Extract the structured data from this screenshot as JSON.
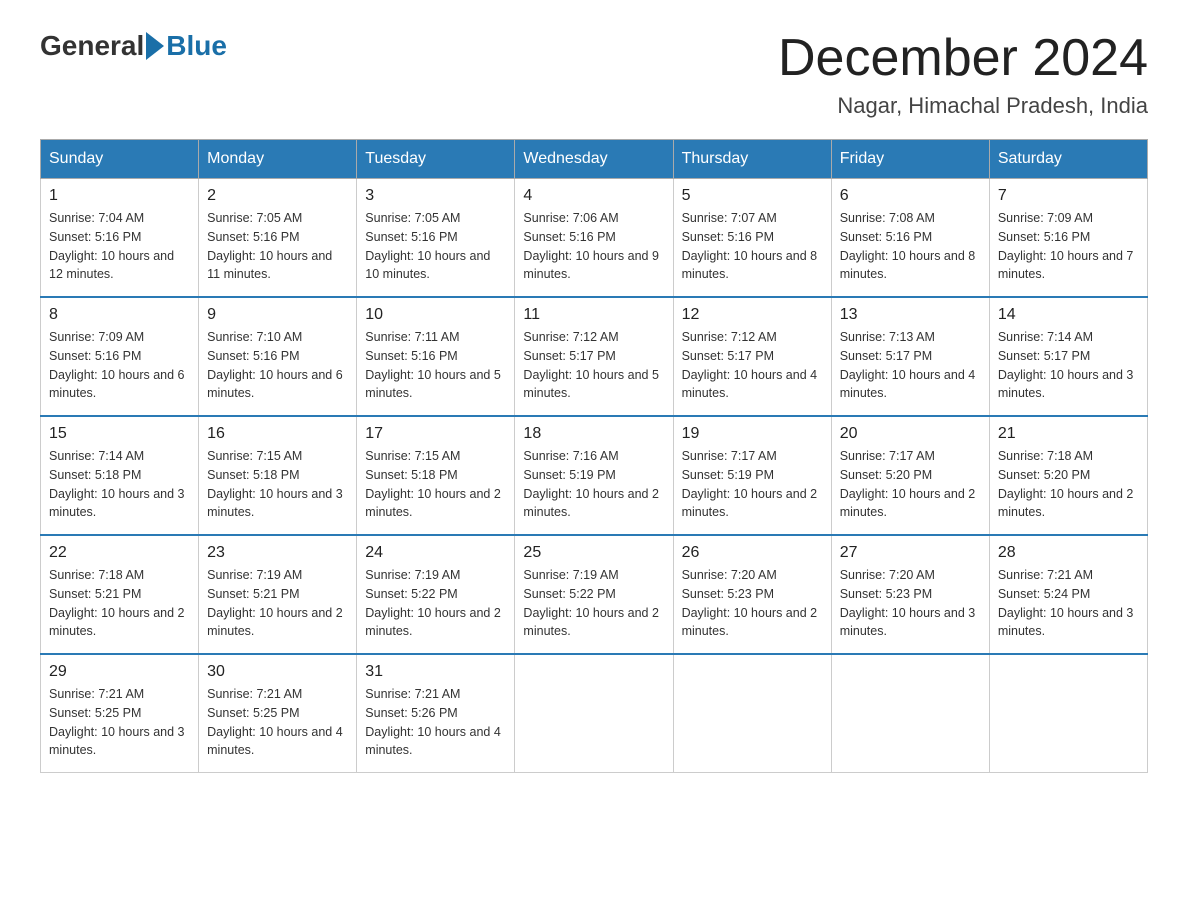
{
  "logo": {
    "general": "General",
    "blue": "Blue"
  },
  "title": "December 2024",
  "subtitle": "Nagar, Himachal Pradesh, India",
  "days": [
    "Sunday",
    "Monday",
    "Tuesday",
    "Wednesday",
    "Thursday",
    "Friday",
    "Saturday"
  ],
  "weeks": [
    [
      {
        "num": "1",
        "sunrise": "7:04 AM",
        "sunset": "5:16 PM",
        "daylight": "10 hours and 12 minutes."
      },
      {
        "num": "2",
        "sunrise": "7:05 AM",
        "sunset": "5:16 PM",
        "daylight": "10 hours and 11 minutes."
      },
      {
        "num": "3",
        "sunrise": "7:05 AM",
        "sunset": "5:16 PM",
        "daylight": "10 hours and 10 minutes."
      },
      {
        "num": "4",
        "sunrise": "7:06 AM",
        "sunset": "5:16 PM",
        "daylight": "10 hours and 9 minutes."
      },
      {
        "num": "5",
        "sunrise": "7:07 AM",
        "sunset": "5:16 PM",
        "daylight": "10 hours and 8 minutes."
      },
      {
        "num": "6",
        "sunrise": "7:08 AM",
        "sunset": "5:16 PM",
        "daylight": "10 hours and 8 minutes."
      },
      {
        "num": "7",
        "sunrise": "7:09 AM",
        "sunset": "5:16 PM",
        "daylight": "10 hours and 7 minutes."
      }
    ],
    [
      {
        "num": "8",
        "sunrise": "7:09 AM",
        "sunset": "5:16 PM",
        "daylight": "10 hours and 6 minutes."
      },
      {
        "num": "9",
        "sunrise": "7:10 AM",
        "sunset": "5:16 PM",
        "daylight": "10 hours and 6 minutes."
      },
      {
        "num": "10",
        "sunrise": "7:11 AM",
        "sunset": "5:16 PM",
        "daylight": "10 hours and 5 minutes."
      },
      {
        "num": "11",
        "sunrise": "7:12 AM",
        "sunset": "5:17 PM",
        "daylight": "10 hours and 5 minutes."
      },
      {
        "num": "12",
        "sunrise": "7:12 AM",
        "sunset": "5:17 PM",
        "daylight": "10 hours and 4 minutes."
      },
      {
        "num": "13",
        "sunrise": "7:13 AM",
        "sunset": "5:17 PM",
        "daylight": "10 hours and 4 minutes."
      },
      {
        "num": "14",
        "sunrise": "7:14 AM",
        "sunset": "5:17 PM",
        "daylight": "10 hours and 3 minutes."
      }
    ],
    [
      {
        "num": "15",
        "sunrise": "7:14 AM",
        "sunset": "5:18 PM",
        "daylight": "10 hours and 3 minutes."
      },
      {
        "num": "16",
        "sunrise": "7:15 AM",
        "sunset": "5:18 PM",
        "daylight": "10 hours and 3 minutes."
      },
      {
        "num": "17",
        "sunrise": "7:15 AM",
        "sunset": "5:18 PM",
        "daylight": "10 hours and 2 minutes."
      },
      {
        "num": "18",
        "sunrise": "7:16 AM",
        "sunset": "5:19 PM",
        "daylight": "10 hours and 2 minutes."
      },
      {
        "num": "19",
        "sunrise": "7:17 AM",
        "sunset": "5:19 PM",
        "daylight": "10 hours and 2 minutes."
      },
      {
        "num": "20",
        "sunrise": "7:17 AM",
        "sunset": "5:20 PM",
        "daylight": "10 hours and 2 minutes."
      },
      {
        "num": "21",
        "sunrise": "7:18 AM",
        "sunset": "5:20 PM",
        "daylight": "10 hours and 2 minutes."
      }
    ],
    [
      {
        "num": "22",
        "sunrise": "7:18 AM",
        "sunset": "5:21 PM",
        "daylight": "10 hours and 2 minutes."
      },
      {
        "num": "23",
        "sunrise": "7:19 AM",
        "sunset": "5:21 PM",
        "daylight": "10 hours and 2 minutes."
      },
      {
        "num": "24",
        "sunrise": "7:19 AM",
        "sunset": "5:22 PM",
        "daylight": "10 hours and 2 minutes."
      },
      {
        "num": "25",
        "sunrise": "7:19 AM",
        "sunset": "5:22 PM",
        "daylight": "10 hours and 2 minutes."
      },
      {
        "num": "26",
        "sunrise": "7:20 AM",
        "sunset": "5:23 PM",
        "daylight": "10 hours and 2 minutes."
      },
      {
        "num": "27",
        "sunrise": "7:20 AM",
        "sunset": "5:23 PM",
        "daylight": "10 hours and 3 minutes."
      },
      {
        "num": "28",
        "sunrise": "7:21 AM",
        "sunset": "5:24 PM",
        "daylight": "10 hours and 3 minutes."
      }
    ],
    [
      {
        "num": "29",
        "sunrise": "7:21 AM",
        "sunset": "5:25 PM",
        "daylight": "10 hours and 3 minutes."
      },
      {
        "num": "30",
        "sunrise": "7:21 AM",
        "sunset": "5:25 PM",
        "daylight": "10 hours and 4 minutes."
      },
      {
        "num": "31",
        "sunrise": "7:21 AM",
        "sunset": "5:26 PM",
        "daylight": "10 hours and 4 minutes."
      },
      null,
      null,
      null,
      null
    ]
  ]
}
